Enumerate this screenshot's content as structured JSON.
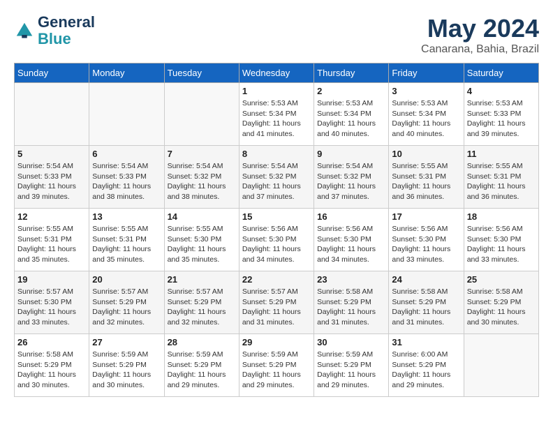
{
  "header": {
    "logo_line1": "General",
    "logo_line2": "Blue",
    "month": "May 2024",
    "location": "Canarana, Bahia, Brazil"
  },
  "weekdays": [
    "Sunday",
    "Monday",
    "Tuesday",
    "Wednesday",
    "Thursday",
    "Friday",
    "Saturday"
  ],
  "weeks": [
    {
      "days": [
        {
          "num": "",
          "info": ""
        },
        {
          "num": "",
          "info": ""
        },
        {
          "num": "",
          "info": ""
        },
        {
          "num": "1",
          "info": "Sunrise: 5:53 AM\nSunset: 5:34 PM\nDaylight: 11 hours and 41 minutes."
        },
        {
          "num": "2",
          "info": "Sunrise: 5:53 AM\nSunset: 5:34 PM\nDaylight: 11 hours and 40 minutes."
        },
        {
          "num": "3",
          "info": "Sunrise: 5:53 AM\nSunset: 5:34 PM\nDaylight: 11 hours and 40 minutes."
        },
        {
          "num": "4",
          "info": "Sunrise: 5:53 AM\nSunset: 5:33 PM\nDaylight: 11 hours and 39 minutes."
        }
      ]
    },
    {
      "days": [
        {
          "num": "5",
          "info": "Sunrise: 5:54 AM\nSunset: 5:33 PM\nDaylight: 11 hours and 39 minutes."
        },
        {
          "num": "6",
          "info": "Sunrise: 5:54 AM\nSunset: 5:33 PM\nDaylight: 11 hours and 38 minutes."
        },
        {
          "num": "7",
          "info": "Sunrise: 5:54 AM\nSunset: 5:32 PM\nDaylight: 11 hours and 38 minutes."
        },
        {
          "num": "8",
          "info": "Sunrise: 5:54 AM\nSunset: 5:32 PM\nDaylight: 11 hours and 37 minutes."
        },
        {
          "num": "9",
          "info": "Sunrise: 5:54 AM\nSunset: 5:32 PM\nDaylight: 11 hours and 37 minutes."
        },
        {
          "num": "10",
          "info": "Sunrise: 5:55 AM\nSunset: 5:31 PM\nDaylight: 11 hours and 36 minutes."
        },
        {
          "num": "11",
          "info": "Sunrise: 5:55 AM\nSunset: 5:31 PM\nDaylight: 11 hours and 36 minutes."
        }
      ]
    },
    {
      "days": [
        {
          "num": "12",
          "info": "Sunrise: 5:55 AM\nSunset: 5:31 PM\nDaylight: 11 hours and 35 minutes."
        },
        {
          "num": "13",
          "info": "Sunrise: 5:55 AM\nSunset: 5:31 PM\nDaylight: 11 hours and 35 minutes."
        },
        {
          "num": "14",
          "info": "Sunrise: 5:55 AM\nSunset: 5:30 PM\nDaylight: 11 hours and 35 minutes."
        },
        {
          "num": "15",
          "info": "Sunrise: 5:56 AM\nSunset: 5:30 PM\nDaylight: 11 hours and 34 minutes."
        },
        {
          "num": "16",
          "info": "Sunrise: 5:56 AM\nSunset: 5:30 PM\nDaylight: 11 hours and 34 minutes."
        },
        {
          "num": "17",
          "info": "Sunrise: 5:56 AM\nSunset: 5:30 PM\nDaylight: 11 hours and 33 minutes."
        },
        {
          "num": "18",
          "info": "Sunrise: 5:56 AM\nSunset: 5:30 PM\nDaylight: 11 hours and 33 minutes."
        }
      ]
    },
    {
      "days": [
        {
          "num": "19",
          "info": "Sunrise: 5:57 AM\nSunset: 5:30 PM\nDaylight: 11 hours and 33 minutes."
        },
        {
          "num": "20",
          "info": "Sunrise: 5:57 AM\nSunset: 5:29 PM\nDaylight: 11 hours and 32 minutes."
        },
        {
          "num": "21",
          "info": "Sunrise: 5:57 AM\nSunset: 5:29 PM\nDaylight: 11 hours and 32 minutes."
        },
        {
          "num": "22",
          "info": "Sunrise: 5:57 AM\nSunset: 5:29 PM\nDaylight: 11 hours and 31 minutes."
        },
        {
          "num": "23",
          "info": "Sunrise: 5:58 AM\nSunset: 5:29 PM\nDaylight: 11 hours and 31 minutes."
        },
        {
          "num": "24",
          "info": "Sunrise: 5:58 AM\nSunset: 5:29 PM\nDaylight: 11 hours and 31 minutes."
        },
        {
          "num": "25",
          "info": "Sunrise: 5:58 AM\nSunset: 5:29 PM\nDaylight: 11 hours and 30 minutes."
        }
      ]
    },
    {
      "days": [
        {
          "num": "26",
          "info": "Sunrise: 5:58 AM\nSunset: 5:29 PM\nDaylight: 11 hours and 30 minutes."
        },
        {
          "num": "27",
          "info": "Sunrise: 5:59 AM\nSunset: 5:29 PM\nDaylight: 11 hours and 30 minutes."
        },
        {
          "num": "28",
          "info": "Sunrise: 5:59 AM\nSunset: 5:29 PM\nDaylight: 11 hours and 29 minutes."
        },
        {
          "num": "29",
          "info": "Sunrise: 5:59 AM\nSunset: 5:29 PM\nDaylight: 11 hours and 29 minutes."
        },
        {
          "num": "30",
          "info": "Sunrise: 5:59 AM\nSunset: 5:29 PM\nDaylight: 11 hours and 29 minutes."
        },
        {
          "num": "31",
          "info": "Sunrise: 6:00 AM\nSunset: 5:29 PM\nDaylight: 11 hours and 29 minutes."
        },
        {
          "num": "",
          "info": ""
        }
      ]
    }
  ]
}
